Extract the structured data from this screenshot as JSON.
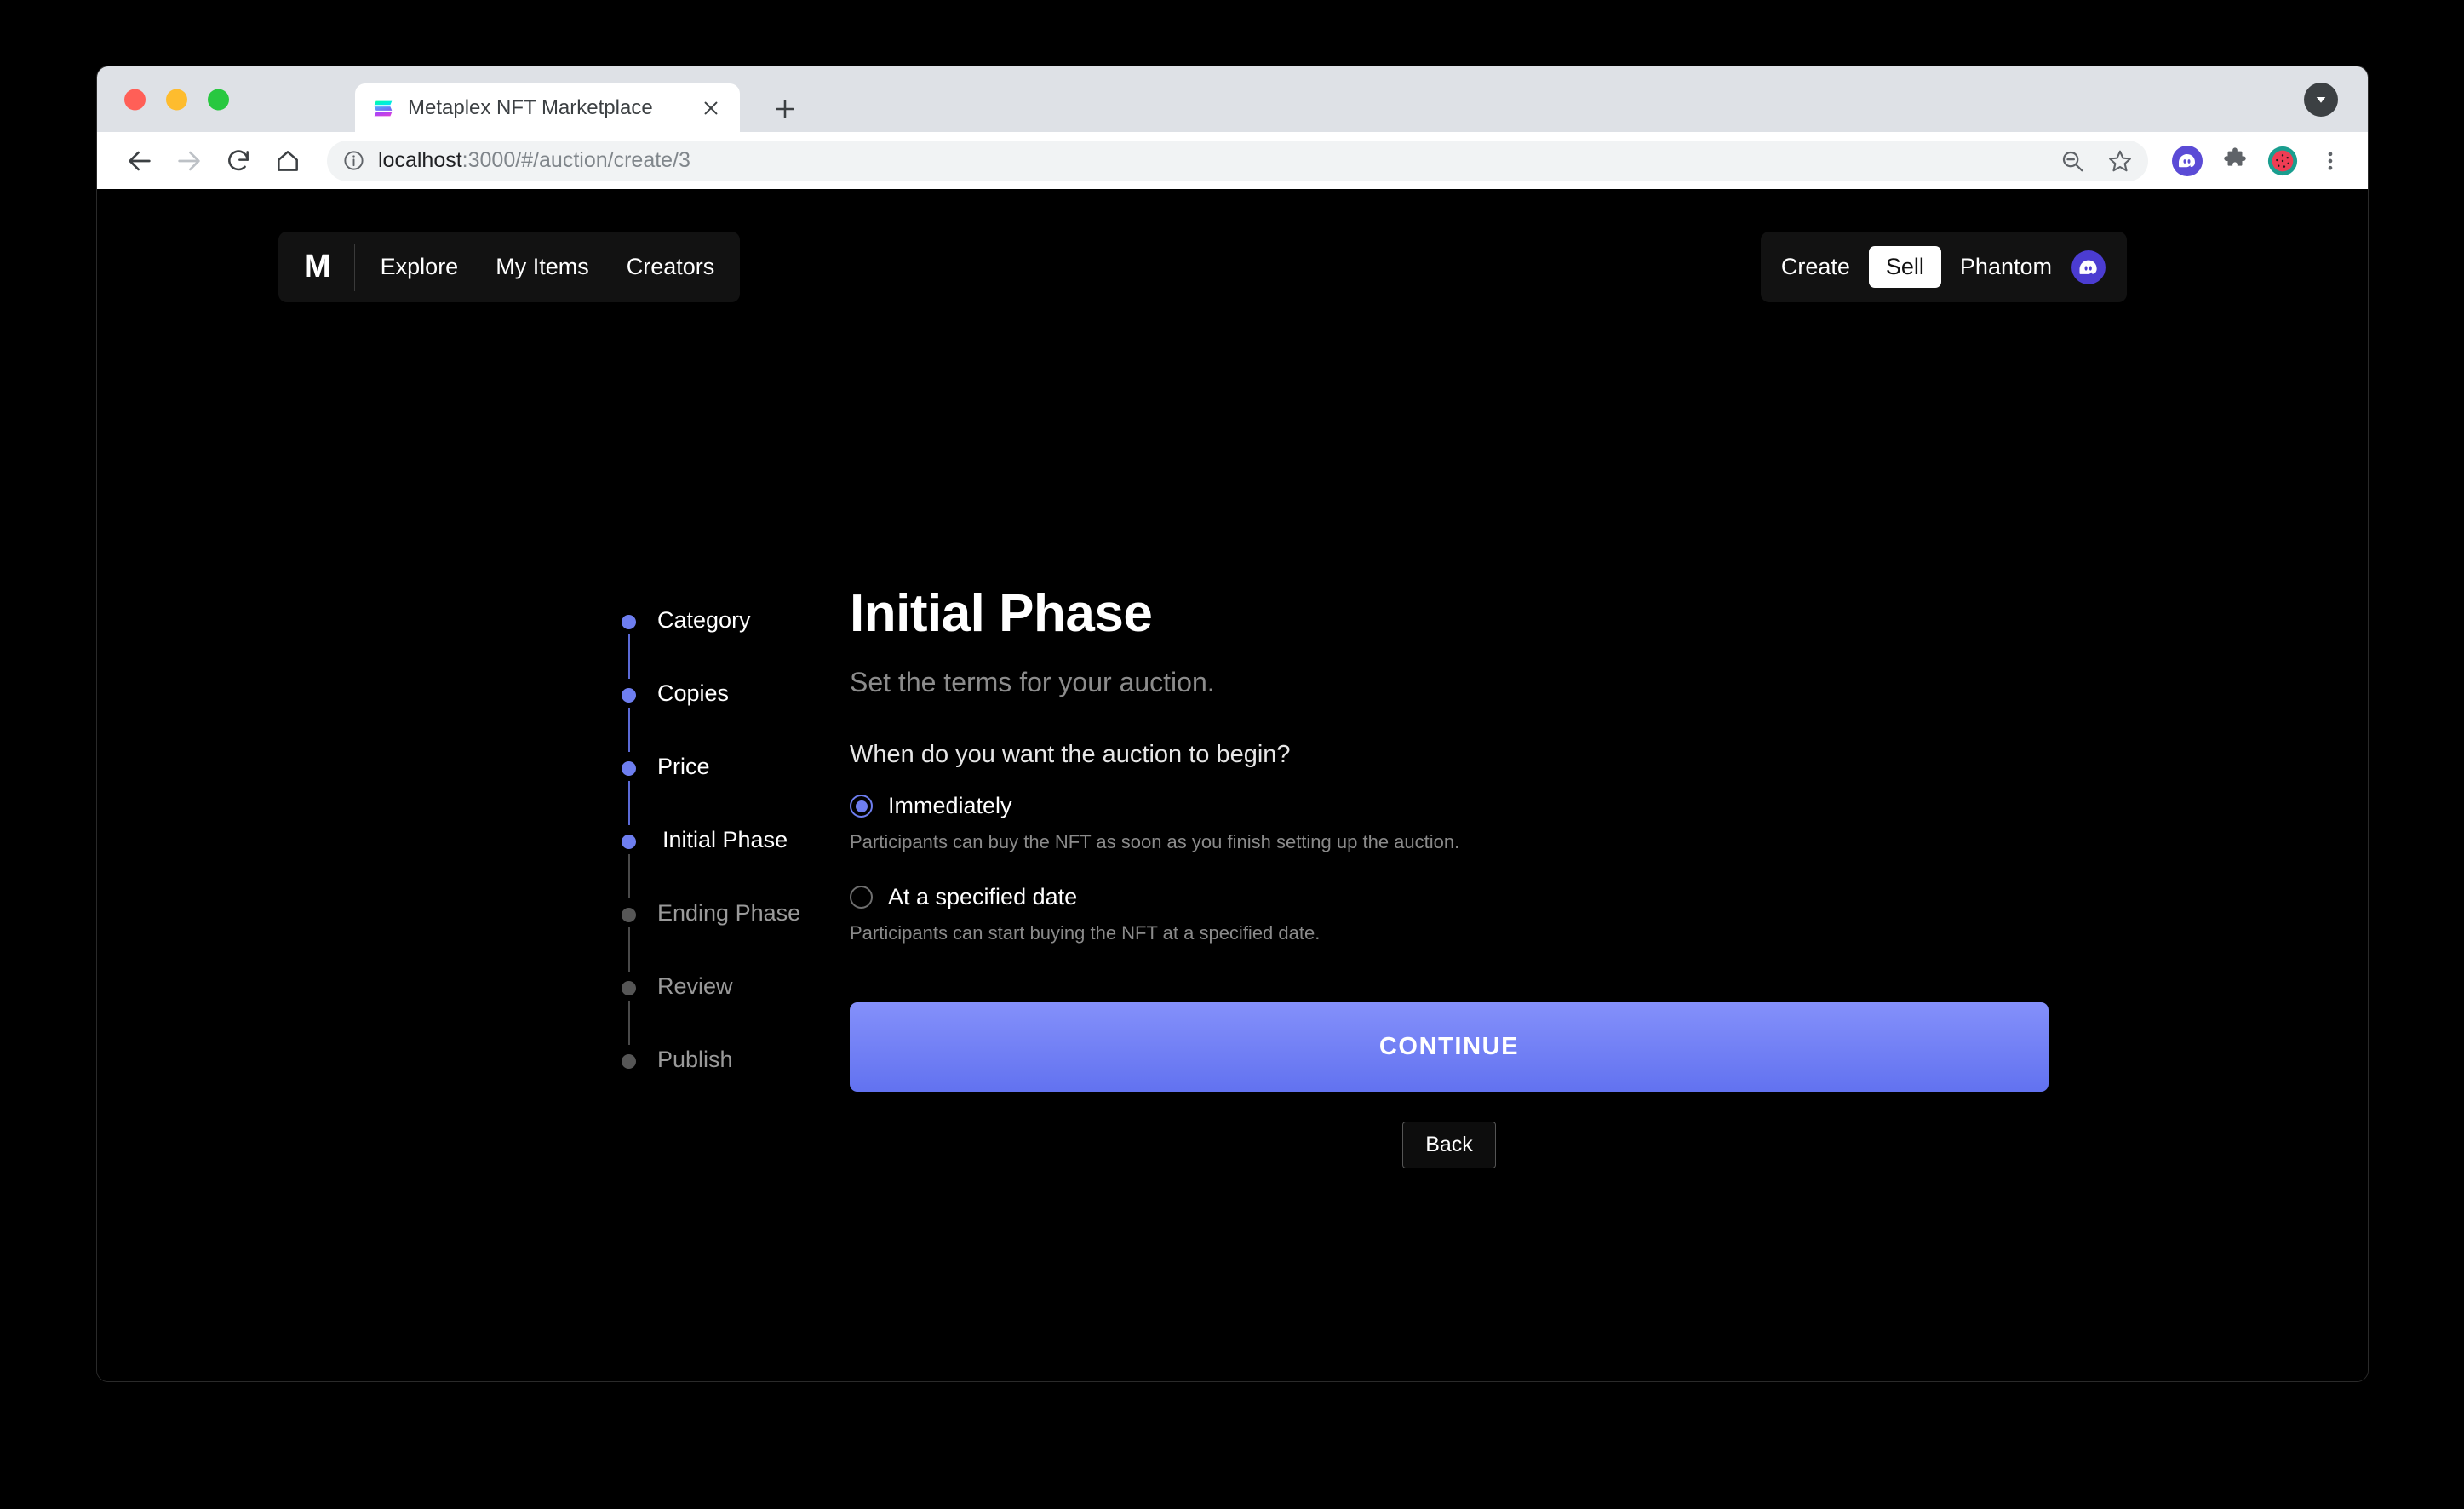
{
  "browser": {
    "tab": {
      "title": "Metaplex NFT Marketplace",
      "favicon": "solana-logo-icon",
      "close_icon": "close-icon"
    },
    "new_tab_icon": "plus-icon",
    "tabstrip_chevron_icon": "chevron-down-icon",
    "toolbar": {
      "back_icon": "back-arrow-icon",
      "forward_icon": "forward-arrow-icon",
      "reload_icon": "reload-icon",
      "home_icon": "home-icon",
      "info_icon": "info-circle-icon",
      "url_host": "localhost",
      "url_rest": ":3000/#/auction/create/3",
      "zoom_out_icon": "zoom-out-icon",
      "bookmark_icon": "star-icon",
      "phantom_icon": "phantom-wallet-icon",
      "extensions_icon": "puzzle-piece-icon",
      "profile_icon": "watermelon-avatar-icon",
      "menu_icon": "three-dot-menu-icon"
    }
  },
  "app": {
    "nav": {
      "logo": "M",
      "links": [
        {
          "label": "Explore"
        },
        {
          "label": "My Items"
        },
        {
          "label": "Creators"
        }
      ]
    },
    "user_nav": {
      "create_label": "Create",
      "sell_label": "Sell",
      "wallet_label": "Phantom",
      "wallet_icon": "phantom-ghost-icon"
    },
    "steps": [
      {
        "label": "Category",
        "state": "done"
      },
      {
        "label": "Copies",
        "state": "done"
      },
      {
        "label": "Price",
        "state": "done"
      },
      {
        "label": "Initial Phase",
        "state": "current"
      },
      {
        "label": "Ending Phase",
        "state": "pending"
      },
      {
        "label": "Review",
        "state": "pending"
      },
      {
        "label": "Publish",
        "state": "pending"
      }
    ],
    "main": {
      "title": "Initial Phase",
      "subtitle": "Set the terms for your auction.",
      "question": "When do you want the auction to begin?",
      "options": [
        {
          "label": "Immediately",
          "description": "Participants can buy the NFT as soon as you finish setting up the auction.",
          "selected": true
        },
        {
          "label": "At a specified date",
          "description": "Participants can start buying the NFT at a specified date.",
          "selected": false
        }
      ],
      "continue_label": "CONTINUE",
      "back_label": "Back"
    }
  },
  "colors": {
    "accent_blue": "#6e7ef0",
    "button_gradient_top": "#8490fa",
    "button_gradient_bottom": "#6272f0",
    "page_background": "#000000",
    "nav_background": "#121212",
    "muted_text": "#8c8c8c"
  }
}
